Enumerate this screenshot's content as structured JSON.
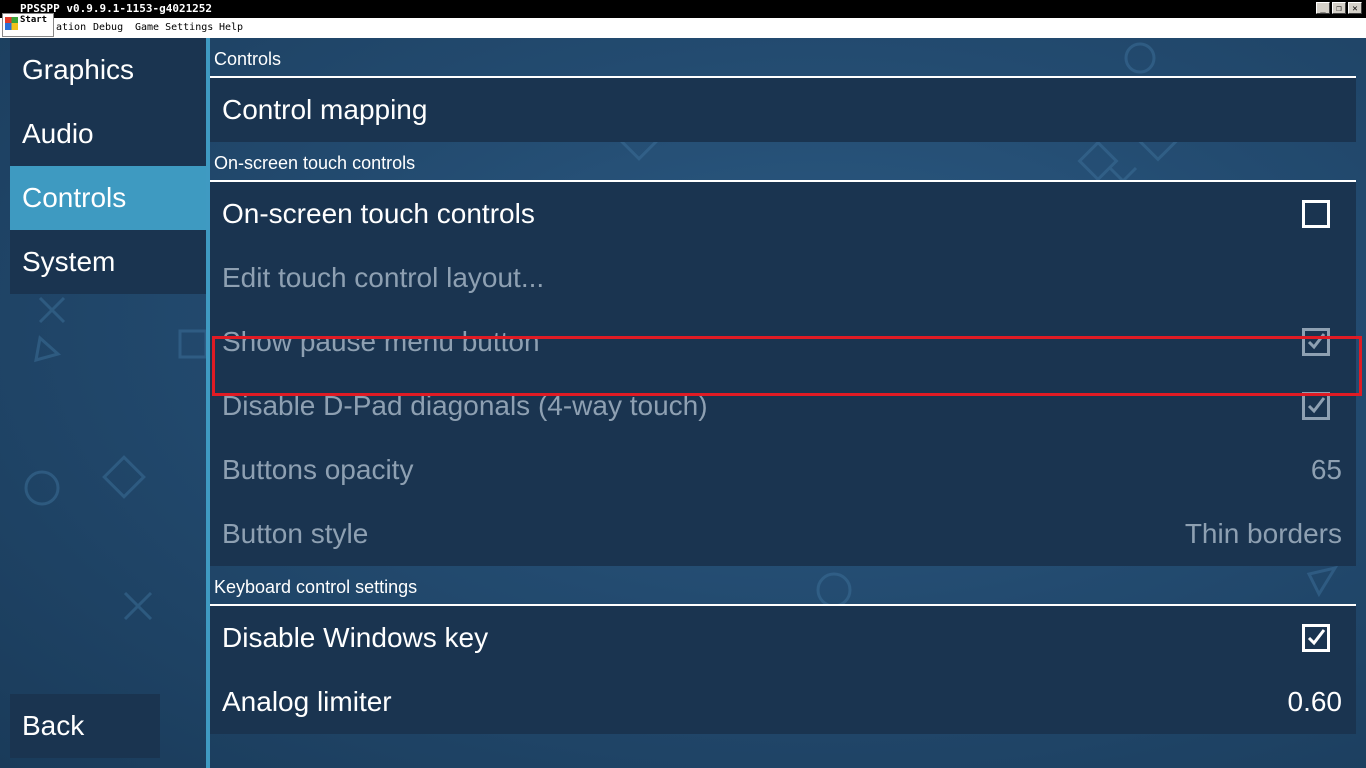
{
  "window": {
    "title": "PPSSPP v0.9.9.1-1153-g4021252",
    "controls": [
      "_",
      "❐",
      "✕"
    ]
  },
  "start_button": {
    "label": "Start"
  },
  "menubar": [
    "ation",
    "Debug",
    "Game Settings",
    "Help"
  ],
  "sidebar": {
    "items": [
      {
        "label": "Graphics",
        "active": false
      },
      {
        "label": "Audio",
        "active": false
      },
      {
        "label": "Controls",
        "active": true
      },
      {
        "label": "System",
        "active": false
      }
    ],
    "back_label": "Back"
  },
  "sections": {
    "controls": {
      "header": "Controls",
      "control_mapping": "Control mapping"
    },
    "touch": {
      "header": "On-screen touch controls",
      "on_screen_touch": {
        "label": "On-screen touch controls",
        "checked": false
      },
      "edit_layout": {
        "label": "Edit touch control layout..."
      },
      "show_pause": {
        "label": "Show pause menu button",
        "checked": true
      },
      "disable_diagonals": {
        "label": "Disable D-Pad diagonals (4-way touch)",
        "checked": true
      },
      "buttons_opacity": {
        "label": "Buttons opacity",
        "value": "65"
      },
      "button_style": {
        "label": "Button style",
        "value": "Thin borders"
      }
    },
    "keyboard": {
      "header": "Keyboard control settings",
      "disable_windows_key": {
        "label": "Disable Windows key",
        "checked": true
      },
      "analog_limiter": {
        "label": "Analog limiter",
        "value": "0.60"
      }
    }
  },
  "colors": {
    "accent": "#3e9ac1",
    "highlight": "#e01b24",
    "row_bg": "#1a3450",
    "disabled_text": "#8ea0b2"
  }
}
